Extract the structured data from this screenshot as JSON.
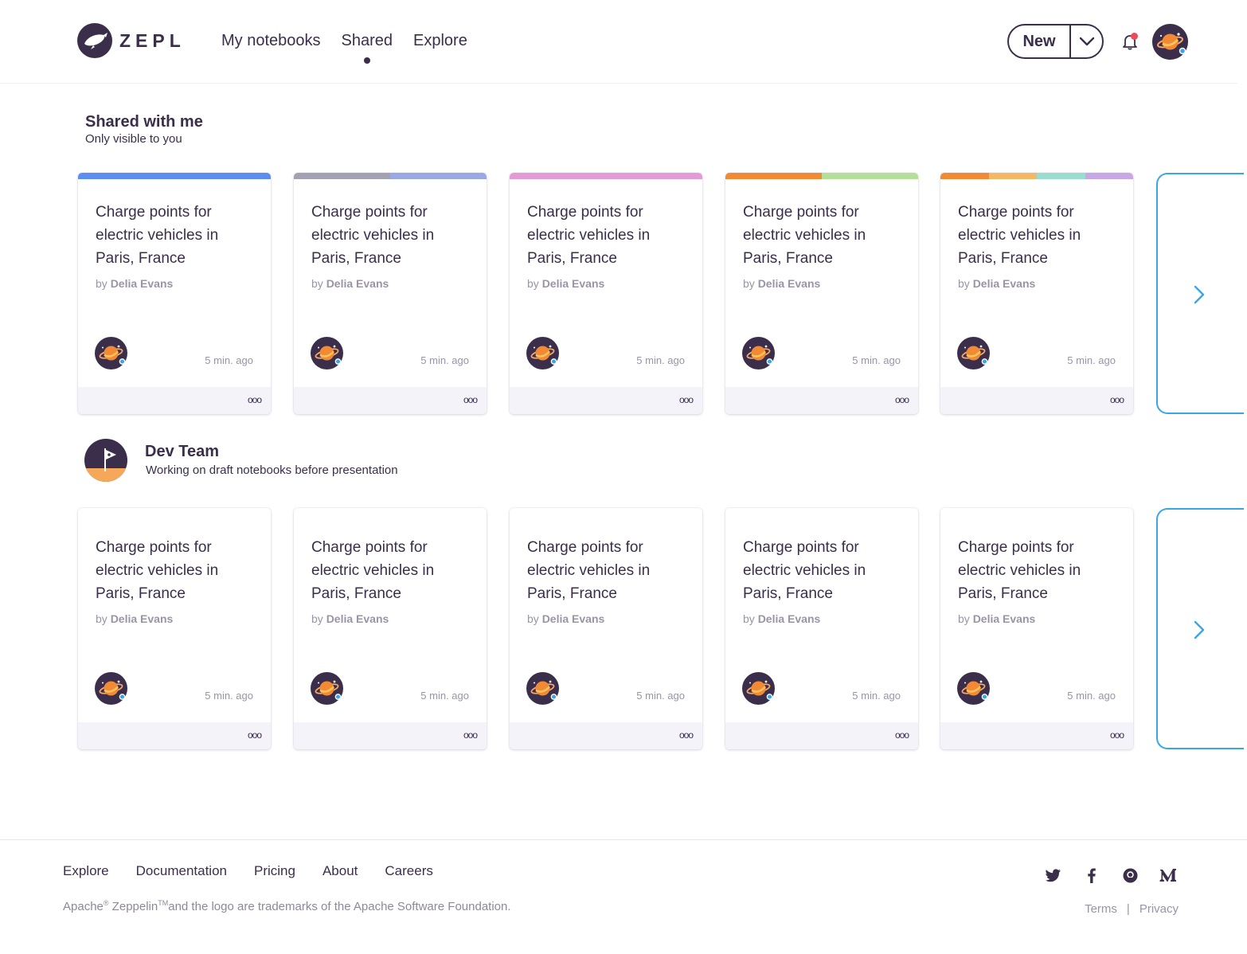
{
  "header": {
    "logo_text": "ZEPL",
    "nav": [
      {
        "label": "My notebooks",
        "active": false
      },
      {
        "label": "Shared",
        "active": true
      },
      {
        "label": "Explore",
        "active": false
      }
    ],
    "new_button_label": "New",
    "notification_dot_color": "#ef4a5a"
  },
  "shared": {
    "title": "Shared with me",
    "subtitle": "Only visible to you",
    "cards": [
      {
        "title": "Charge points for electric vehicles in Paris, France",
        "by": "by",
        "author": "Delia Evans",
        "time": "5 min. ago",
        "more": "ooo",
        "colors": [
          "#5b8ef0"
        ]
      },
      {
        "title": "Charge points for electric vehicles in Paris, France",
        "by": "by",
        "author": "Delia Evans",
        "time": "5 min. ago",
        "more": "ooo",
        "colors": [
          "#a3a2b3",
          "#9aa8e6"
        ]
      },
      {
        "title": "Charge points for electric vehicles in Paris, France",
        "by": "by",
        "author": "Delia Evans",
        "time": "5 min. ago",
        "more": "ooo",
        "colors": [
          "#e59ad8"
        ]
      },
      {
        "title": "Charge points for electric vehicles in Paris, France",
        "by": "by",
        "author": "Delia Evans",
        "time": "5 min. ago",
        "more": "ooo",
        "colors": [
          "#f28a35",
          "#b3df98"
        ]
      },
      {
        "title": "Charge points for electric vehicles in Paris, France",
        "by": "by",
        "author": "Delia Evans",
        "time": "5 min. ago",
        "more": "ooo",
        "colors": [
          "#f28a35",
          "#f5b765",
          "#98ddd0",
          "#c9a6e6"
        ]
      }
    ]
  },
  "team": {
    "title": "Dev Team",
    "subtitle": "Working on draft notebooks before presentation",
    "cards": [
      {
        "title": "Charge points for electric vehicles in Paris, France",
        "by": "by",
        "author": "Delia Evans",
        "time": "5 min. ago",
        "more": "ooo"
      },
      {
        "title": "Charge points for electric vehicles in Paris, France",
        "by": "by",
        "author": "Delia Evans",
        "time": "5 min. ago",
        "more": "ooo"
      },
      {
        "title": "Charge points for electric vehicles in Paris, France",
        "by": "by",
        "author": "Delia Evans",
        "time": "5 min. ago",
        "more": "ooo"
      },
      {
        "title": "Charge points for electric vehicles in Paris, France",
        "by": "by",
        "author": "Delia Evans",
        "time": "5 min. ago",
        "more": "ooo"
      },
      {
        "title": "Charge points for electric vehicles in Paris, France",
        "by": "by",
        "author": "Delia Evans",
        "time": "5 min. ago",
        "more": "ooo"
      }
    ]
  },
  "footer": {
    "links": [
      "Explore",
      "Documentation",
      "Pricing",
      "About",
      "Careers"
    ],
    "legal": {
      "apache": "Apache",
      "reg": "®",
      "zeppelin": " Zeppelin",
      "tm": "TM",
      "rest": "and the logo are trademarks of the Apache Software Foundation."
    },
    "social_icons": [
      "twitter-icon",
      "facebook-icon",
      "github-icon",
      "medium-icon"
    ],
    "terms": "Terms",
    "separator": "|",
    "privacy": "Privacy"
  },
  "colors": {
    "text": "#3b2e4a",
    "muted": "#9a94a6",
    "accent_blue": "#3aa6e8",
    "card_footer": "#f4f3fa"
  }
}
